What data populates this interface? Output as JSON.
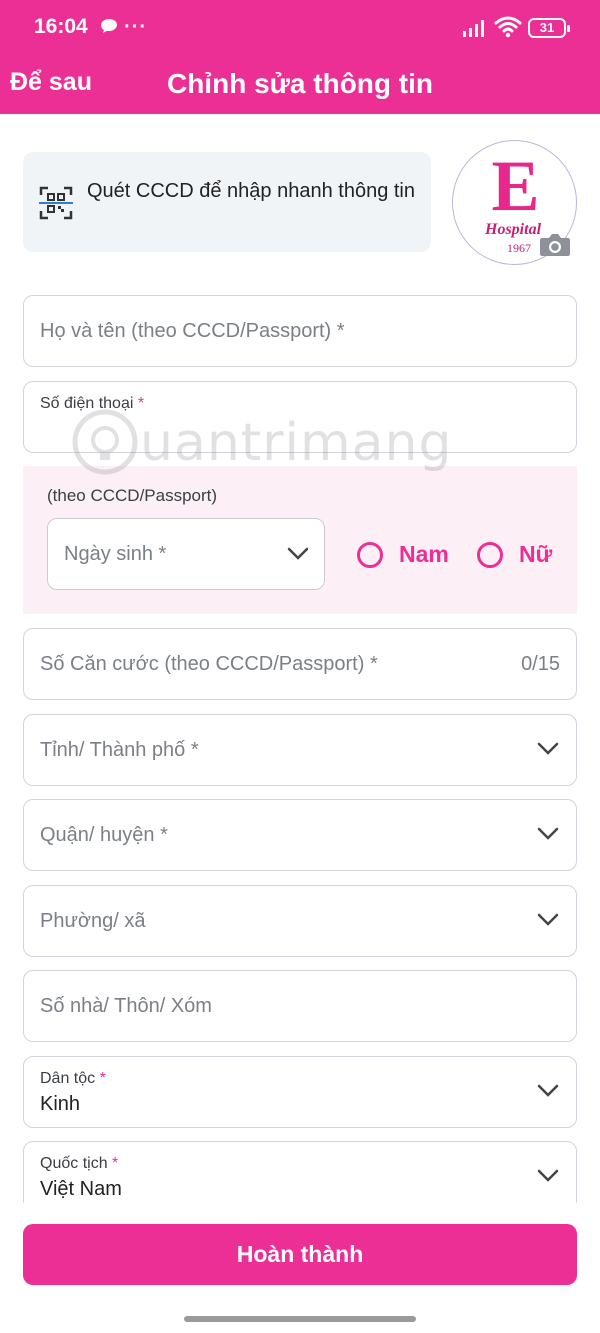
{
  "status_bar": {
    "time": "16:04",
    "more": "···",
    "battery": "31"
  },
  "app_bar": {
    "later": "Để sau",
    "title": "Chỉnh sửa thông tin"
  },
  "scan": {
    "text": "Quét CCCD để nhập nhanh thông tin"
  },
  "avatar": {
    "logo_letter": "E",
    "logo_hospital": "Hospital",
    "logo_year": "1967"
  },
  "fields": {
    "full_name": {
      "placeholder": "Họ và tên (theo CCCD/Passport) *"
    },
    "phone": {
      "label": "Số điện thoại",
      "required_mark": "*"
    },
    "dob_note": "(theo CCCD/Passport)",
    "dob": {
      "placeholder": "Ngày sinh *"
    },
    "gender": {
      "male": "Nam",
      "female": "Nữ"
    },
    "id_number": {
      "placeholder": "Số Căn cước (theo CCCD/Passport) *",
      "counter": "0/15"
    },
    "province": {
      "placeholder": "Tỉnh/ Thành phố *"
    },
    "district": {
      "placeholder": "Quận/ huyện *"
    },
    "ward": {
      "placeholder": "Phường/ xã"
    },
    "address": {
      "placeholder": "Số nhà/ Thôn/ Xóm"
    },
    "ethnicity": {
      "label": "Dân tộc",
      "required_mark": "*",
      "value": "Kinh"
    },
    "nationality": {
      "label": "Quốc tịch",
      "required_mark": "*",
      "value": "Việt Nam"
    }
  },
  "watermark": "uantrimang",
  "footer": {
    "done_label": "Hoàn thành"
  },
  "colors": {
    "brand": "#ec2f95",
    "border": "#d0d5dc",
    "placeholder": "#7b7f86"
  },
  "icons": {
    "chat": "chat-bubble-icon",
    "signal": "signal-icon",
    "wifi": "wifi-icon",
    "qr": "qr-scan-icon",
    "camera": "camera-icon",
    "chevron": "chevron-down-icon",
    "radio": "radio-unchecked-icon"
  }
}
